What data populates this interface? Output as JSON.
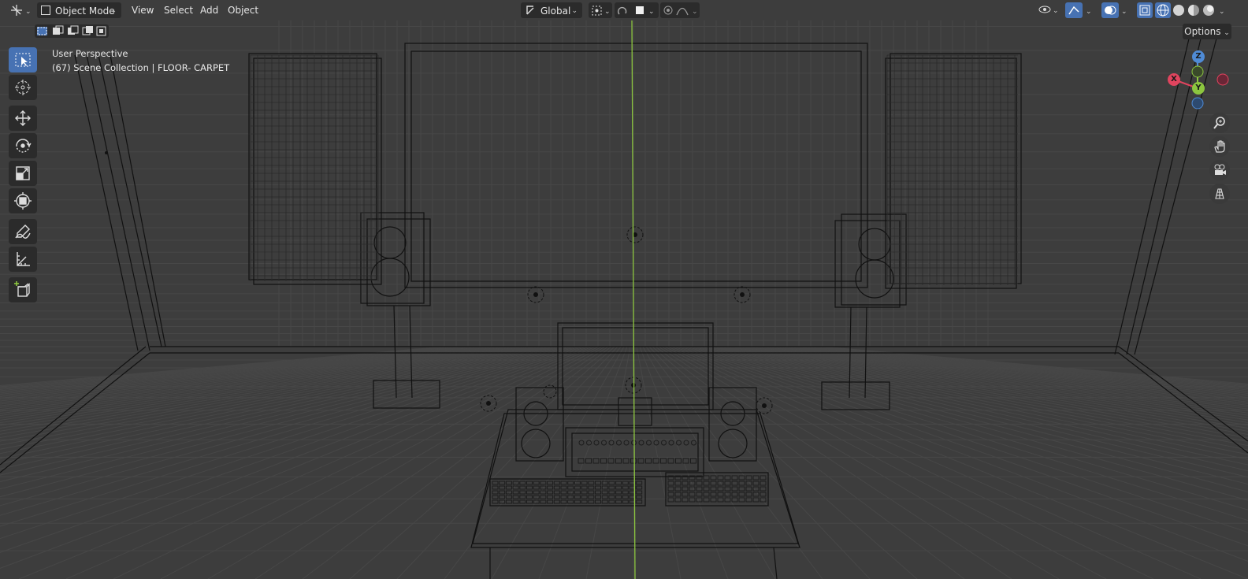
{
  "header": {
    "mode": "Object Mode",
    "menus": [
      "View",
      "Select",
      "Add",
      "Object"
    ],
    "orientation": "Global",
    "options_label": "Options"
  },
  "overlay": {
    "view_name": "User Perspective",
    "collection_info": "(67) Scene Collection | FLOOR- CARPET"
  },
  "gizmo": {
    "x": "X",
    "y": "Y",
    "z": "Z"
  },
  "toolbar": {
    "tools": [
      "select-box",
      "cursor",
      "move",
      "rotate",
      "scale",
      "transform",
      "annotate",
      "measure",
      "add-cube"
    ],
    "active": "select-box"
  },
  "colors": {
    "accent": "#4772b3",
    "grid_bg": "#3d3d3d",
    "y_axis": "#8cc63f",
    "x_axis": "#e0445e",
    "z_axis": "#4f8bd6"
  }
}
